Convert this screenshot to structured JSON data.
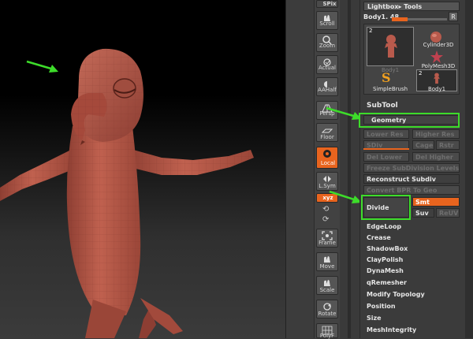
{
  "shelf": {
    "top_label": "SPix",
    "buttons": [
      {
        "name": "scroll",
        "label": "Scroll",
        "active": false
      },
      {
        "name": "zoom",
        "label": "Zoom",
        "active": false
      },
      {
        "name": "actual",
        "label": "Actual",
        "active": false
      },
      {
        "name": "aahalf",
        "label": "AAHalf",
        "active": false
      },
      {
        "name": "persp",
        "label": "Persp",
        "active": false
      },
      {
        "name": "floor",
        "label": "Floor",
        "active": false
      },
      {
        "name": "local",
        "label": "Local",
        "active": true
      },
      {
        "name": "lsym",
        "label": "L.Sym",
        "active": false
      },
      {
        "name": "xyz",
        "label": "xyz",
        "active": true
      },
      {
        "name": "frame",
        "label": "Frame",
        "active": false
      },
      {
        "name": "move",
        "label": "Move",
        "active": false
      },
      {
        "name": "scale",
        "label": "Scale",
        "active": false
      },
      {
        "name": "rotate",
        "label": "Rotate",
        "active": false
      },
      {
        "name": "polyf",
        "label": "PolyF",
        "active": false
      }
    ]
  },
  "palette": {
    "lightbox_tools": "Lightbox▸ Tools",
    "tool_name": "Body1. 48",
    "r_label": "R",
    "tiles": [
      {
        "name": "body1-main",
        "label": "Body1",
        "count": "2"
      },
      {
        "name": "cylinder3d",
        "label": "Cylinder3D",
        "count": ""
      },
      {
        "name": "polymesh3d",
        "label": "PolyMesh3D",
        "count": ""
      },
      {
        "name": "simplebrush",
        "label": "SimpleBrush",
        "count": ""
      },
      {
        "name": "body1-small",
        "label": "Body1",
        "count": "2"
      }
    ],
    "subtool_header": "SubTool",
    "geometry_label": "Geometry",
    "lower_res": "Lower Res",
    "higher_res": "Higher Res",
    "sdiv": "SDiv",
    "cage": "Cage",
    "rstr": "Rstr",
    "del_lower": "Del Lower",
    "del_higher": "Del Higher",
    "freeze": "Freeze SubDivision Levels",
    "reconstruct": "Reconstruct Subdiv",
    "convert": "Convert BPR To Geo",
    "divide": "Divide",
    "smt": "Smt",
    "suv": "Suv",
    "reuv": "ReUV",
    "menu_items": [
      "EdgeLoop",
      "Crease",
      "ShadowBox",
      "ClayPolish",
      "DynaMesh",
      "qRemesher",
      "Modify Topology",
      "Position",
      "Size",
      "MeshIntegrity"
    ]
  },
  "colors": {
    "accent": "#e8641e",
    "highlight": "#3ddc2a",
    "model": "#b85a4c"
  }
}
